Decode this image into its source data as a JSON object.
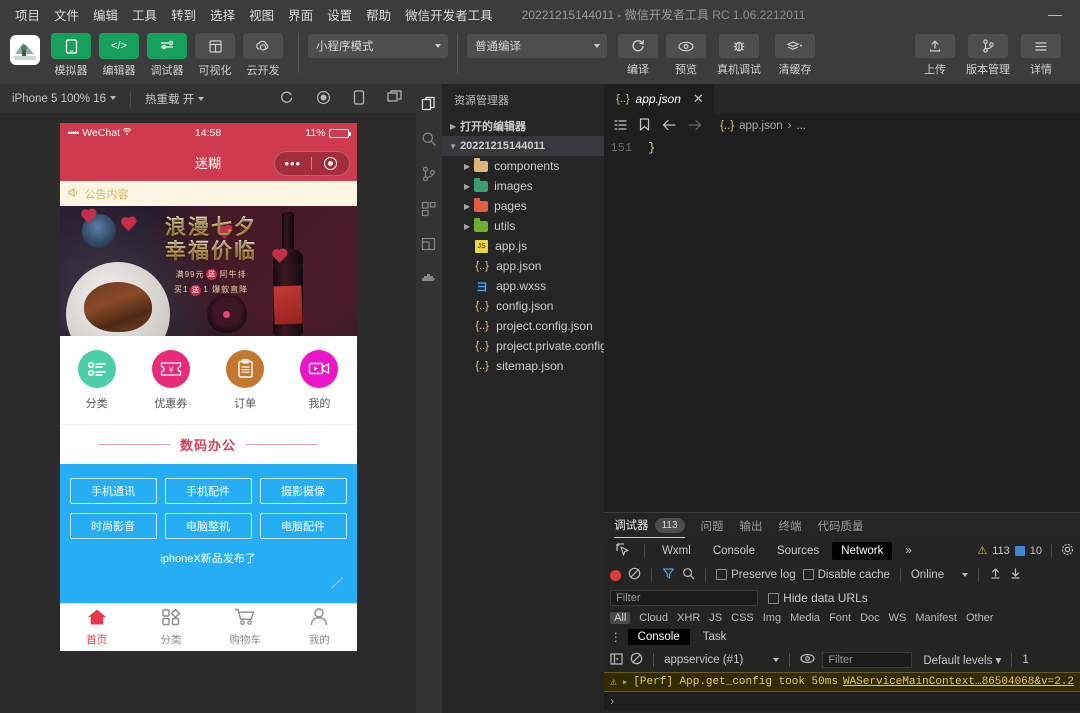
{
  "menubar": {
    "items": [
      "项目",
      "文件",
      "编辑",
      "工具",
      "转到",
      "选择",
      "视图",
      "界面",
      "设置",
      "帮助",
      "微信开发者工具"
    ],
    "title": "20221215144011 - 微信开发者工具",
    "version": "RC 1.06.2212011",
    "minimize": "—"
  },
  "toolbar": {
    "buttons": [
      {
        "label": "模拟器",
        "icon": "phone-icon",
        "style": "green"
      },
      {
        "label": "编辑器",
        "icon": "code-icon",
        "style": "green"
      },
      {
        "label": "调试器",
        "icon": "debug-icon",
        "style": "green"
      },
      {
        "label": "可视化",
        "icon": "layout-icon",
        "style": "grey"
      },
      {
        "label": "云开发",
        "icon": "cloud-icon",
        "style": "grey"
      }
    ],
    "mode_select": "小程序模式",
    "compile_select": "普通编译",
    "actions": [
      {
        "label": "编译",
        "icon": "refresh-icon"
      },
      {
        "label": "预览",
        "icon": "eye-icon"
      },
      {
        "label": "真机调试",
        "icon": "bug-icon"
      },
      {
        "label": "清缓存",
        "icon": "layers-icon"
      }
    ],
    "right_actions": [
      {
        "label": "上传",
        "icon": "upload-icon"
      },
      {
        "label": "版本管理",
        "icon": "branch-icon"
      },
      {
        "label": "详情",
        "icon": "menu-icon"
      }
    ]
  },
  "simulator": {
    "device": "iPhone 5 100% 16",
    "hot_reload": "热重载 开",
    "icons": [
      "refresh-icon",
      "record-icon",
      "rotate-icon",
      "window-icon"
    ],
    "phone": {
      "status": {
        "carrier": "WeChat",
        "signal_dots": "•••••",
        "wifi": "wifi-icon",
        "time": "14:58",
        "battery": "11%"
      },
      "nav_title": "迷糊",
      "capsule": {
        "dots": "•••",
        "target": "target-icon"
      },
      "notice": {
        "icon": "speaker-icon",
        "text": "公告内容"
      },
      "banner": {
        "line1": "浪漫七夕",
        "line2": "幸福价临",
        "sub1_pre": "满99元",
        "sub1_chip": "送",
        "sub1_post": "阿牛排",
        "sub2_pre": "买1",
        "sub2_chip": "送",
        "sub2_post": "1 爆款直降"
      },
      "quick_icons": [
        {
          "label": "分类",
          "icon": "list-icon",
          "color": "#4ecdaa"
        },
        {
          "label": "优惠券",
          "icon": "coupon-icon",
          "color": "#ea2a7a"
        },
        {
          "label": "订单",
          "icon": "order-icon",
          "color": "#c4772e"
        },
        {
          "label": "我的",
          "icon": "video-icon",
          "color": "#ec14c8"
        }
      ],
      "section_title": "数码办公",
      "categories": [
        [
          "手机通讯",
          "手机配件",
          "摄影摄像"
        ],
        [
          "时尚影音",
          "电脑整机",
          "电脑配件"
        ]
      ],
      "note": "iphoneX新品发布了",
      "tabs": [
        {
          "label": "首页",
          "icon": "home-icon",
          "active": true
        },
        {
          "label": "分类",
          "icon": "grid-icon",
          "active": false
        },
        {
          "label": "购物车",
          "icon": "cart-icon",
          "active": false
        },
        {
          "label": "我的",
          "icon": "person-icon",
          "active": false
        }
      ]
    }
  },
  "explorer": {
    "activity_icons": [
      "files-icon",
      "search-icon",
      "source-control-icon",
      "extensions-icon",
      "editor-icon",
      "cloud-docker-icon"
    ],
    "title": "资源管理器",
    "more": "···",
    "sections": [
      {
        "label": "打开的编辑器",
        "expanded": false
      },
      {
        "label": "20221215144011",
        "expanded": true,
        "selected": true
      }
    ],
    "tree": [
      {
        "label": "components",
        "type": "folder",
        "color": "#dcb67a",
        "indent": 2
      },
      {
        "label": "images",
        "type": "folder",
        "color": "#3a9e6e",
        "indent": 2
      },
      {
        "label": "pages",
        "type": "folder",
        "color": "#e05d44",
        "indent": 2
      },
      {
        "label": "utils",
        "type": "folder",
        "color": "#6fae2f",
        "indent": 2
      },
      {
        "label": "app.js",
        "type": "js",
        "indent": 3
      },
      {
        "label": "app.json",
        "type": "json",
        "indent": 3
      },
      {
        "label": "app.wxss",
        "type": "wxss",
        "indent": 3
      },
      {
        "label": "config.json",
        "type": "json",
        "indent": 3
      },
      {
        "label": "project.config.json",
        "type": "json",
        "indent": 3
      },
      {
        "label": "project.private.config.js...",
        "type": "json",
        "indent": 3
      },
      {
        "label": "sitemap.json",
        "type": "json",
        "indent": 3
      }
    ]
  },
  "editor": {
    "tab": {
      "name": "app.json",
      "icon": "json-icon",
      "close": "✕"
    },
    "breadcrumb_icons": [
      "outline-icon",
      "bookmark-icon",
      "back-arrow-icon",
      "forward-arrow-icon"
    ],
    "breadcrumb": {
      "file": "app.json",
      "separator": "›",
      "rest": "..."
    },
    "lines": [
      {
        "number": "151",
        "text": "}"
      }
    ]
  },
  "debugger": {
    "tabs": [
      {
        "label": "调试器",
        "badge": "113",
        "active": true
      },
      {
        "label": "问题",
        "badge": "",
        "active": false
      },
      {
        "label": "输出",
        "badge": "",
        "active": false
      },
      {
        "label": "终端",
        "badge": "",
        "active": false
      },
      {
        "label": "代码质量",
        "badge": "",
        "active": false
      }
    ],
    "devtools_tabs": [
      "Wxml",
      "Console",
      "Sources",
      "Network"
    ],
    "devtools_active": "Network",
    "devtools_more": "»",
    "counters": {
      "warnings": "113",
      "infos": "10"
    },
    "network": {
      "preserve_log": "Preserve log",
      "disable_cache": "Disable cache",
      "online": "Online",
      "filter_placeholder": "Filter",
      "hide_data_urls": "Hide data URLs",
      "types": [
        "All",
        "Cloud",
        "XHR",
        "JS",
        "CSS",
        "Img",
        "Media",
        "Font",
        "Doc",
        "WS",
        "Manifest",
        "Other"
      ]
    },
    "console": {
      "tabs": [
        "Console",
        "Task"
      ],
      "active_tab": "Console",
      "context": "appservice (#1)",
      "filter_placeholder": "Filter",
      "levels": "Default levels ▾",
      "issue_count": "1",
      "log": {
        "icon": "warning-icon",
        "text": "[Perf] App.get_config took 50ms",
        "source": "WAServiceMainContext…86504068&v=2.2"
      },
      "prompt": "›"
    }
  }
}
